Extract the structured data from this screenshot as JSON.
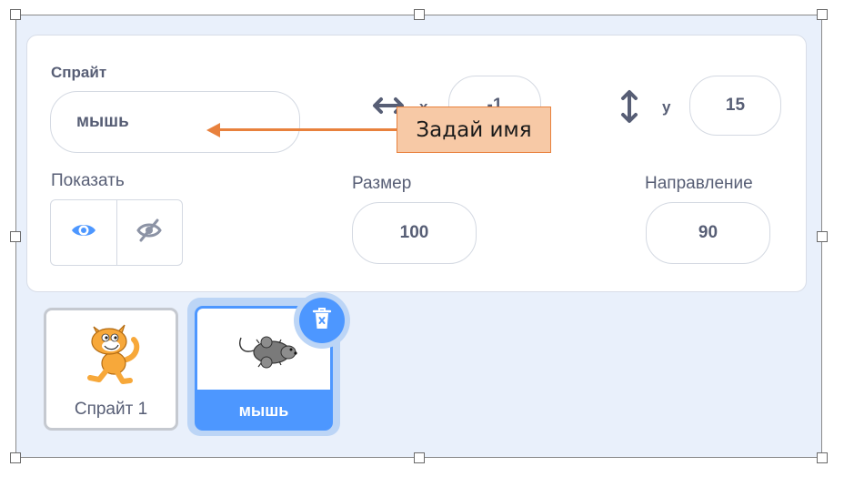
{
  "sprite_info": {
    "sprite_label": "Спрайт",
    "sprite_name": "мышь",
    "x_label": "x",
    "x_value": "-1",
    "y_label": "y",
    "y_value": "15",
    "show_label": "Показать",
    "size_label": "Размер",
    "size_value": "100",
    "direction_label": "Направление",
    "direction_value": "90"
  },
  "annotation": {
    "callout_text": "Задай имя",
    "color": "#e8813d"
  },
  "sprites": [
    {
      "label": "Спрайт 1",
      "icon": "cat-costume",
      "selected": false
    },
    {
      "label": "мышь",
      "icon": "mouse-costume",
      "selected": true
    }
  ],
  "colors": {
    "accent": "#4d97ff",
    "text": "#575e75",
    "panel_bg": "#e9f0fb"
  }
}
